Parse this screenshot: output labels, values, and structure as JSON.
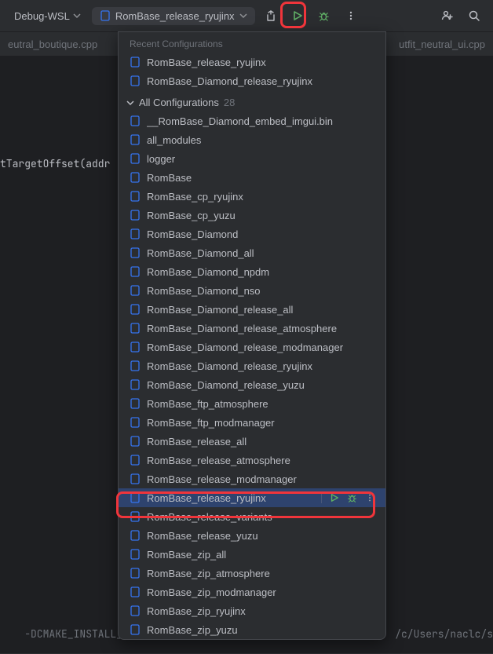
{
  "toolbar": {
    "build_label": "Debug-WSL",
    "config_label": "RomBase_release_ryujinx"
  },
  "tabs": {
    "left": "eutral_boutique.cpp",
    "right": "utfit_neutral_ui.cpp"
  },
  "code": {
    "line1": "tTargetOffset(addr",
    "line2_a": "-DCMAKE_INSTALL_P",
    "line2_b": "/c/Users/naclc/s"
  },
  "popup": {
    "recent_title": "Recent Configurations",
    "recent": [
      "RomBase_release_ryujinx",
      "RomBase_Diamond_release_ryujinx"
    ],
    "all_title": "All Configurations",
    "all_count": "28",
    "selected_index": 20,
    "items": [
      "__RomBase_Diamond_embed_imgui.bin",
      "all_modules",
      "logger",
      "RomBase",
      "RomBase_cp_ryujinx",
      "RomBase_cp_yuzu",
      "RomBase_Diamond",
      "RomBase_Diamond_all",
      "RomBase_Diamond_npdm",
      "RomBase_Diamond_nso",
      "RomBase_Diamond_release_all",
      "RomBase_Diamond_release_atmosphere",
      "RomBase_Diamond_release_modmanager",
      "RomBase_Diamond_release_ryujinx",
      "RomBase_Diamond_release_yuzu",
      "RomBase_ftp_atmosphere",
      "RomBase_ftp_modmanager",
      "RomBase_release_all",
      "RomBase_release_atmosphere",
      "RomBase_release_modmanager",
      "RomBase_release_ryujinx",
      "RomBase_release_variants",
      "RomBase_release_yuzu",
      "RomBase_zip_all",
      "RomBase_zip_atmosphere",
      "RomBase_zip_modmanager",
      "RomBase_zip_ryujinx",
      "RomBase_zip_yuzu"
    ]
  },
  "icons": {
    "play_color": "#5fad65",
    "bug_color": "#5fad65",
    "file_stroke": "#3574f0"
  }
}
